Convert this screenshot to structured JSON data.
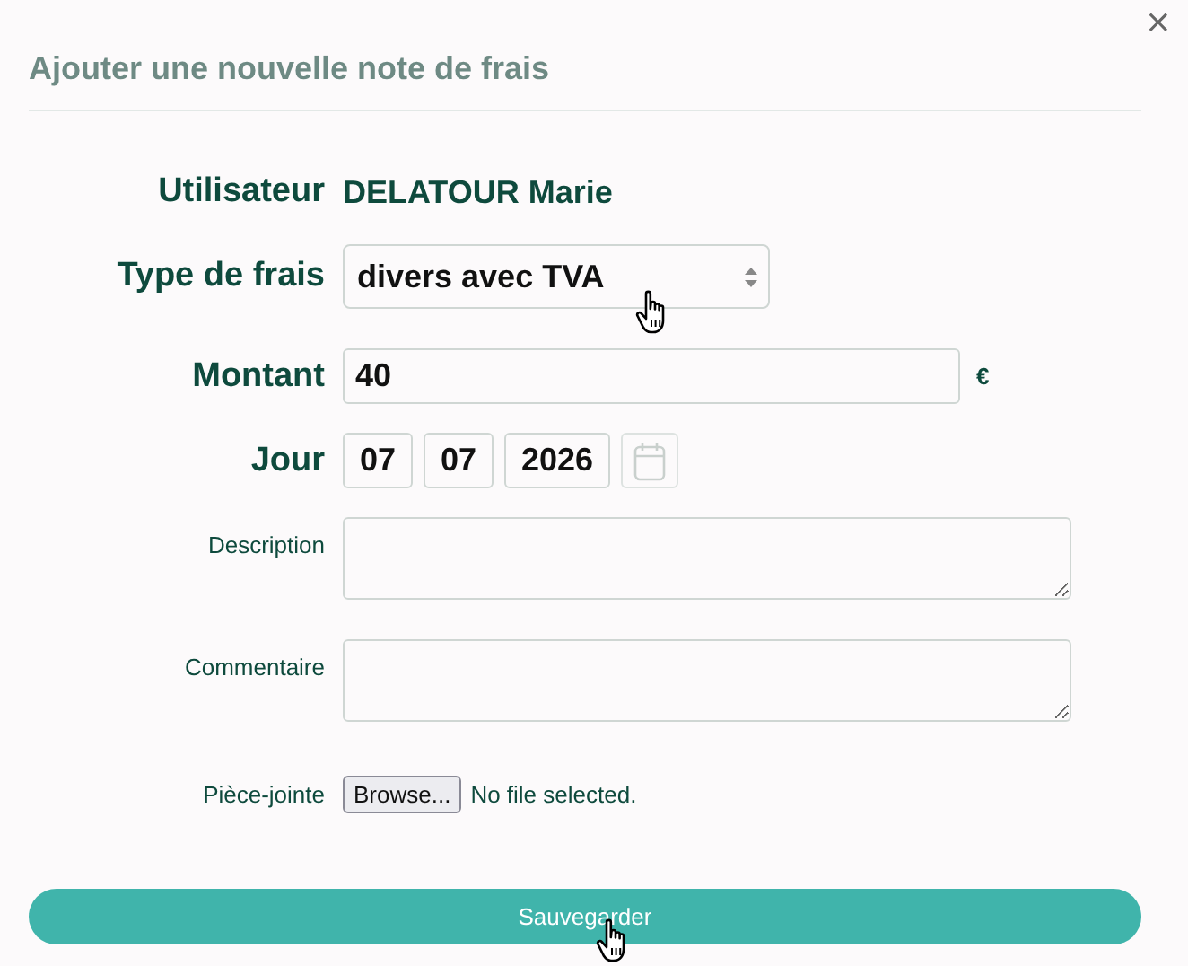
{
  "dialog": {
    "title": "Ajouter une nouvelle note de frais",
    "close": "×"
  },
  "form": {
    "user": {
      "label": "Utilisateur",
      "value": "DELATOUR Marie"
    },
    "type": {
      "label": "Type de frais",
      "value": "divers avec TVA"
    },
    "amount": {
      "label": "Montant",
      "value": "40",
      "unit": "€"
    },
    "day": {
      "label": "Jour",
      "day": "07",
      "month": "07",
      "year": "2026"
    },
    "description": {
      "label": "Description"
    },
    "comment": {
      "label": "Commentaire"
    },
    "attachment": {
      "label": "Pièce-jointe",
      "button": "Browse...",
      "status": "No file selected."
    }
  },
  "save_button": "Sauvegarder"
}
